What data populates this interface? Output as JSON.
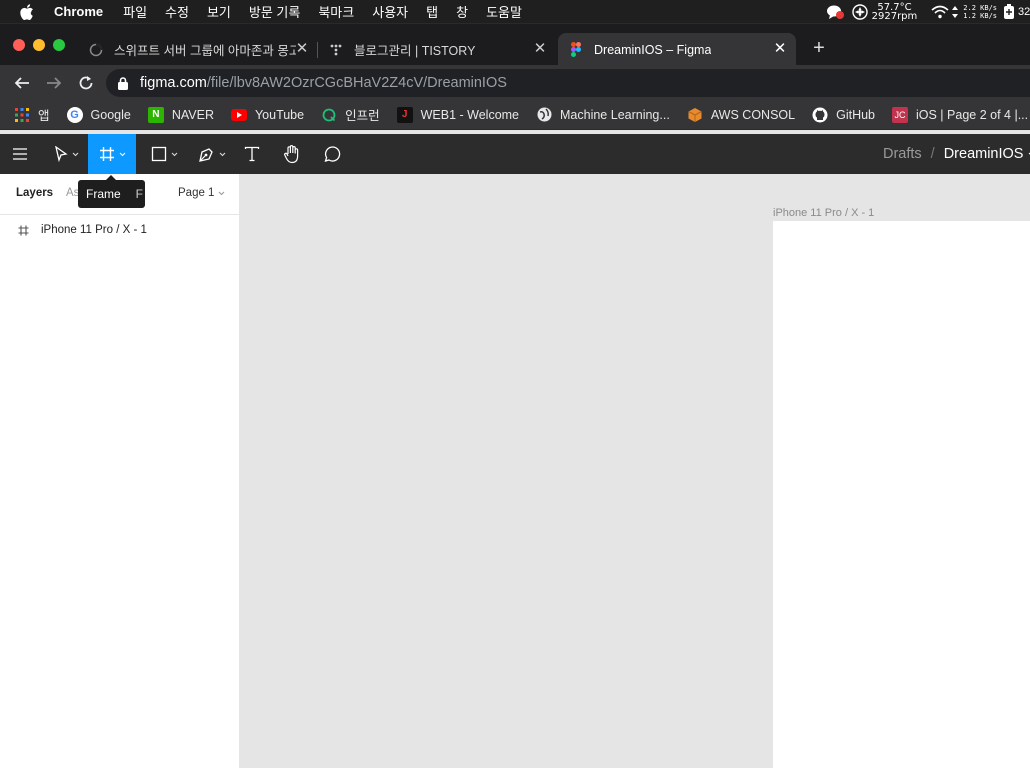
{
  "colors": {
    "menubar_bg": "#1f1f1f",
    "chrome_bg": "#1c1c1e",
    "chrome_active": "#353537",
    "figma_toolbar": "#2c2c2c",
    "figma_accent": "#0d99ff",
    "canvas_bg": "#e5e5e5"
  },
  "menubar": {
    "app_name": "Chrome",
    "items": [
      "파일",
      "수정",
      "보기",
      "방문 기록",
      "북마크",
      "사용자",
      "탭",
      "창",
      "도움말"
    ],
    "status": {
      "temp": "57.7°C",
      "rpm": "2927rpm",
      "net_up": "2.2 KB/s",
      "net_down": "1.2 KB/s",
      "battery_text": "32"
    }
  },
  "tabs": [
    {
      "title": "스위프트 서버 그룹에 아마존과 몽고디비...",
      "icon": "loading-icon",
      "active": false
    },
    {
      "title": "블로그관리 | TISTORY",
      "icon": "tistory-icon",
      "active": false
    },
    {
      "title": "DreaminIOS – Figma",
      "icon": "figma-icon",
      "active": true
    }
  ],
  "address": {
    "host": "figma.com",
    "path": "/file/lbv8AW2OzrCGcBHaV2Z4cV/DreaminIOS"
  },
  "bookmarks": [
    {
      "label": "앱",
      "icon": "apps-grid-icon"
    },
    {
      "label": "Google",
      "icon": "google-icon"
    },
    {
      "label": "NAVER",
      "icon": "naver-icon"
    },
    {
      "label": "YouTube",
      "icon": "youtube-icon"
    },
    {
      "label": "인프런",
      "icon": "inflearn-icon"
    },
    {
      "label": "WEB1 - Welcome",
      "icon": "web1-icon"
    },
    {
      "label": "Machine Learning...",
      "icon": "globe-icon"
    },
    {
      "label": "AWS CONSOL",
      "icon": "aws-icon"
    },
    {
      "label": "GitHub",
      "icon": "github-icon"
    },
    {
      "label": "iOS | Page 2 of 4 |...",
      "icon": "jc-icon"
    }
  ],
  "figma": {
    "breadcrumb": {
      "folder": "Drafts",
      "separator": "/",
      "file": "DreaminIOS"
    },
    "tooltip": {
      "label": "Frame",
      "shortcut": "F"
    },
    "panel_tabs": {
      "layers": "Layers",
      "assets": "Assets",
      "page": "Page 1"
    },
    "layers": [
      {
        "name": "iPhone 11 Pro / X - 1",
        "icon": "frame-icon"
      }
    ],
    "canvas": {
      "frame_label": "iPhone 11 Pro / X - 1"
    }
  }
}
